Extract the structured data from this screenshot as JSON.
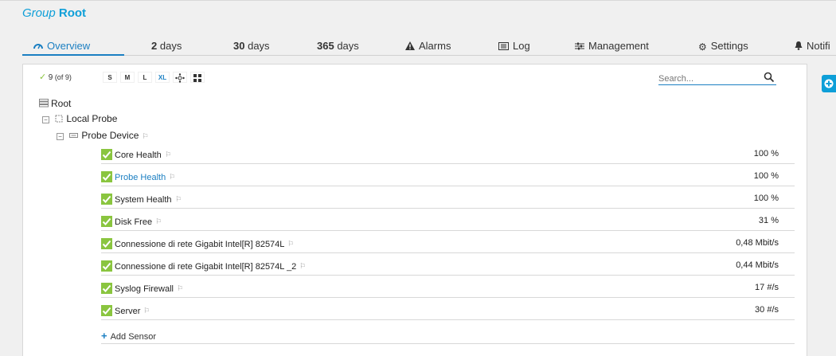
{
  "header": {
    "group_prefix": "Group",
    "group_name": "Root"
  },
  "tabs": [
    {
      "label": "Overview",
      "icon": "gauge-icon",
      "active": true
    },
    {
      "label_bold": "2",
      "label": "days"
    },
    {
      "label_bold": "30",
      "label": "days"
    },
    {
      "label_bold": "365",
      "label": "days"
    },
    {
      "label": "Alarms",
      "icon": "warning-icon"
    },
    {
      "label": "Log",
      "icon": "log-icon"
    },
    {
      "label": "Management",
      "icon": "sliders-icon"
    },
    {
      "label": "Settings",
      "icon": "gear-icon"
    },
    {
      "label": "Notifi",
      "icon": "bell-icon"
    }
  ],
  "toolbar": {
    "count": "9",
    "of": "(of 9)",
    "sizes": [
      "S",
      "M",
      "L",
      "XL"
    ],
    "search_placeholder": "Search..."
  },
  "tree": {
    "root": "Root",
    "probe": "Local Probe",
    "device": "Probe Device"
  },
  "sensors": [
    {
      "name": "Core Health",
      "value": "100 %"
    },
    {
      "name": "Probe Health",
      "value": "100 %",
      "link": true
    },
    {
      "name": "System Health",
      "value": "100 %"
    },
    {
      "name": "Disk Free",
      "value": "31 %"
    },
    {
      "name": "Connessione di rete Gigabit Intel[R] 82574L",
      "value": "0,48 Mbit/s"
    },
    {
      "name": "Connessione di rete Gigabit Intel[R] 82574L _2",
      "value": "0,44 Mbit/s"
    },
    {
      "name": "Syslog Firewall",
      "value": "17 #/s"
    },
    {
      "name": "Server",
      "value": "30 #/s"
    }
  ],
  "add_sensor_label": "Add Sensor",
  "colors": {
    "accent": "#1b7fc2",
    "title_blue": "#0e9fd8",
    "ok_green": "#8ac53f"
  }
}
